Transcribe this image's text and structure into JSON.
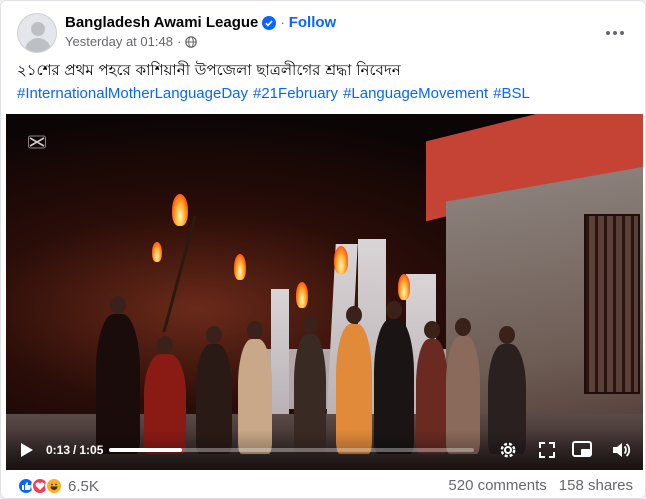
{
  "post": {
    "page_name": "Bangladesh Awami League",
    "follow_label": "Follow",
    "separator": "·",
    "timestamp": "Yesterday at 01:48",
    "separator2": "·",
    "text": "২১শের প্রথম পহরে কাশিয়ানী উপজেলা ছাত্রলীগের শ্রদ্ধা নিবেদন",
    "hashtags": [
      "#InternationalMotherLanguageDay",
      "#21February",
      "#LanguageMovement",
      "#BSL"
    ]
  },
  "video": {
    "current_time": "0:13",
    "time_separator": "/",
    "duration": "1:05",
    "progress_fraction": 0.2
  },
  "footer": {
    "reaction_count": "6.5K",
    "comments": "520 comments",
    "shares": "158 shares"
  },
  "colors": {
    "link": "#0866ff",
    "secondary_text": "#65676b",
    "like": "#0866ff",
    "love": "#f33e58",
    "haha": "#f7b125"
  },
  "icons": {
    "avatar": "default-avatar",
    "verified": "verified-badge-icon",
    "privacy": "globe-icon",
    "more": "more-horizontal-icon",
    "watermark": "capcut-icon",
    "play": "play-icon",
    "settings": "gear-icon",
    "fullscreen": "expand-icon",
    "pip": "picture-in-picture-icon",
    "volume": "volume-icon",
    "reactions": [
      "like-icon",
      "love-icon",
      "haha-icon"
    ]
  }
}
